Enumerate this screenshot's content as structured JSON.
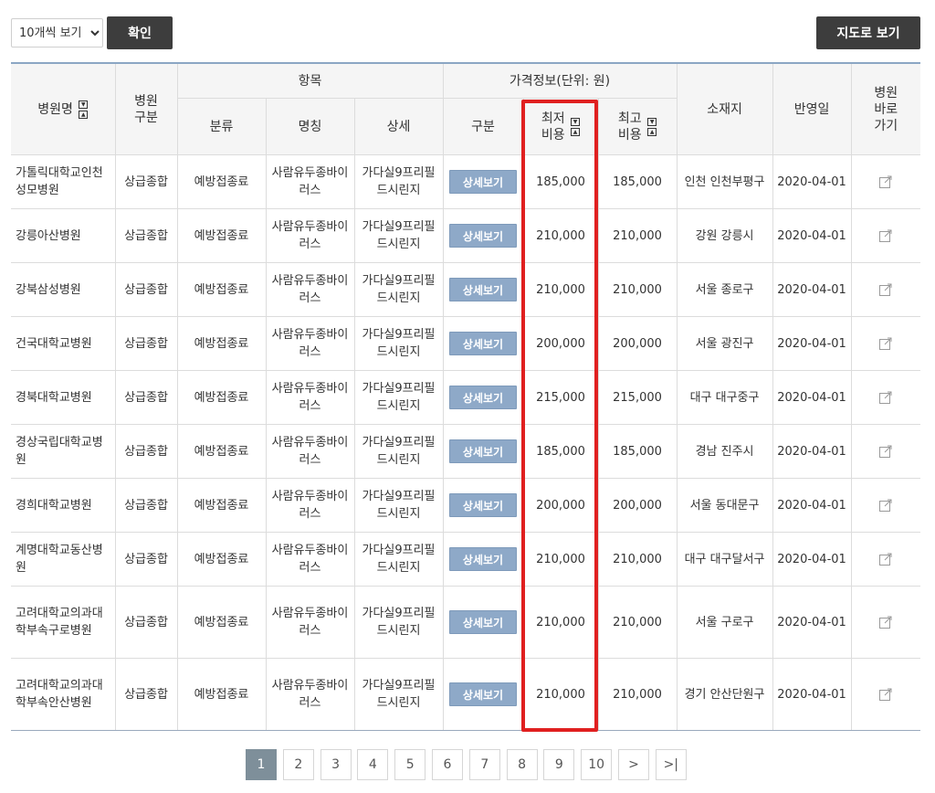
{
  "toolbar": {
    "per_page_selected": "10개씩 보기",
    "confirm_label": "확인",
    "map_view_label": "지도로 보기"
  },
  "table": {
    "headers": {
      "hospital_name": "병원명",
      "hospital_type": "병원\n구분",
      "item_group": "항목",
      "category": "분류",
      "name": "명칭",
      "detail": "상세",
      "price_group": "가격정보(단위: 원)",
      "division": "구분",
      "min_cost": "최저\n비용",
      "max_cost": "최고\n비용",
      "location": "소재지",
      "reflect_date": "반영일",
      "hospital_link": "병원\n바로\n가기"
    },
    "detail_button_label": "상세보기",
    "rows": [
      {
        "name": "가톨릭대학교인천성모병원",
        "type": "상급종합",
        "category": "예방접종료",
        "item": "사람유두종바이러스",
        "detail": "가다실9프리필드시린지",
        "min": "185,000",
        "max": "185,000",
        "location": "인천 인천부평구",
        "date": "2020-04-01"
      },
      {
        "name": "강릉아산병원",
        "type": "상급종합",
        "category": "예방접종료",
        "item": "사람유두종바이러스",
        "detail": "가다실9프리필드시린지",
        "min": "210,000",
        "max": "210,000",
        "location": "강원 강릉시",
        "date": "2020-04-01"
      },
      {
        "name": "강북삼성병원",
        "type": "상급종합",
        "category": "예방접종료",
        "item": "사람유두종바이러스",
        "detail": "가다실9프리필드시린지",
        "min": "210,000",
        "max": "210,000",
        "location": "서울 종로구",
        "date": "2020-04-01"
      },
      {
        "name": "건국대학교병원",
        "type": "상급종합",
        "category": "예방접종료",
        "item": "사람유두종바이러스",
        "detail": "가다실9프리필드시린지",
        "min": "200,000",
        "max": "200,000",
        "location": "서울 광진구",
        "date": "2020-04-01"
      },
      {
        "name": "경북대학교병원",
        "type": "상급종합",
        "category": "예방접종료",
        "item": "사람유두종바이러스",
        "detail": "가다실9프리필드시린지",
        "min": "215,000",
        "max": "215,000",
        "location": "대구 대구중구",
        "date": "2020-04-01"
      },
      {
        "name": "경상국립대학교병원",
        "type": "상급종합",
        "category": "예방접종료",
        "item": "사람유두종바이러스",
        "detail": "가다실9프리필드시린지",
        "min": "185,000",
        "max": "185,000",
        "location": "경남 진주시",
        "date": "2020-04-01"
      },
      {
        "name": "경희대학교병원",
        "type": "상급종합",
        "category": "예방접종료",
        "item": "사람유두종바이러스",
        "detail": "가다실9프리필드시린지",
        "min": "200,000",
        "max": "200,000",
        "location": "서울 동대문구",
        "date": "2020-04-01"
      },
      {
        "name": "계명대학교동산병원",
        "type": "상급종합",
        "category": "예방접종료",
        "item": "사람유두종바이러스",
        "detail": "가다실9프리필드시린지",
        "min": "210,000",
        "max": "210,000",
        "location": "대구 대구달서구",
        "date": "2020-04-01"
      },
      {
        "name": "고려대학교의과대학부속구로병원",
        "type": "상급종합",
        "category": "예방접종료",
        "item": "사람유두종바이러스",
        "detail": "가다실9프리필드시린지",
        "min": "210,000",
        "max": "210,000",
        "location": "서울 구로구",
        "date": "2020-04-01"
      },
      {
        "name": "고려대학교의과대학부속안산병원",
        "type": "상급종합",
        "category": "예방접종료",
        "item": "사람유두종바이러스",
        "detail": "가다실9프리필드시린지",
        "min": "210,000",
        "max": "210,000",
        "location": "경기 안산단원구",
        "date": "2020-04-01"
      }
    ]
  },
  "pagination": {
    "pages": [
      "1",
      "2",
      "3",
      "4",
      "5",
      "6",
      "7",
      "8",
      "9",
      "10"
    ],
    "active_page": "1",
    "next_label": ">",
    "last_label": ">|"
  },
  "colors": {
    "accent_highlight": "#e02020",
    "detail_button": "#8ea9c8",
    "dark_button": "#3d3d3d",
    "active_page": "#7e8f9a"
  }
}
